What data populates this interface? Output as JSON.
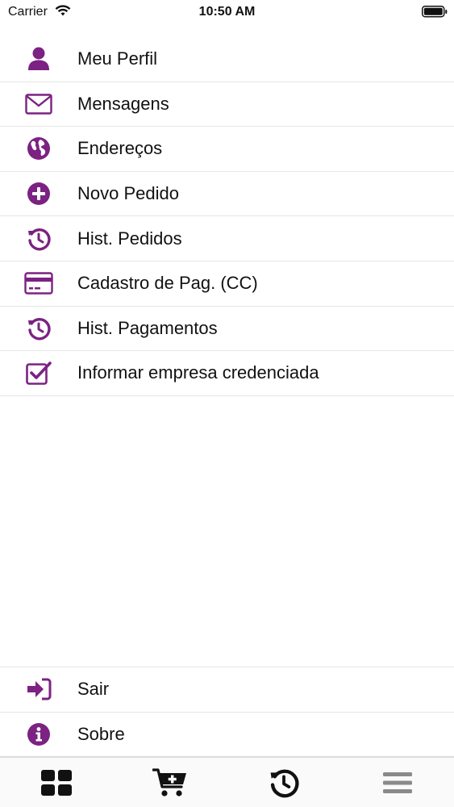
{
  "status_bar": {
    "carrier": "Carrier",
    "time": "10:50 AM"
  },
  "accent_color": "#7b2282",
  "menu": {
    "items": [
      {
        "label": "Meu Perfil",
        "icon": "user-icon"
      },
      {
        "label": "Mensagens",
        "icon": "envelope-icon"
      },
      {
        "label": "Endereços",
        "icon": "globe-icon"
      },
      {
        "label": "Novo Pedido",
        "icon": "plus-circle-icon"
      },
      {
        "label": "Hist. Pedidos",
        "icon": "history-icon"
      },
      {
        "label": "Cadastro de Pag. (CC)",
        "icon": "credit-card-icon"
      },
      {
        "label": "Hist. Pagamentos",
        "icon": "history-icon"
      },
      {
        "label": "Informar empresa credenciada",
        "icon": "check-square-icon"
      }
    ],
    "bottom_items": [
      {
        "label": "Sair",
        "icon": "sign-in-icon"
      },
      {
        "label": "Sobre",
        "icon": "info-circle-icon"
      }
    ]
  },
  "tab_bar": {
    "tabs": [
      {
        "icon": "grid-icon",
        "color": "#111111"
      },
      {
        "icon": "cart-plus-icon",
        "color": "#111111"
      },
      {
        "icon": "history-icon",
        "color": "#111111"
      },
      {
        "icon": "menu-icon",
        "color": "#8a8a8a"
      }
    ]
  }
}
